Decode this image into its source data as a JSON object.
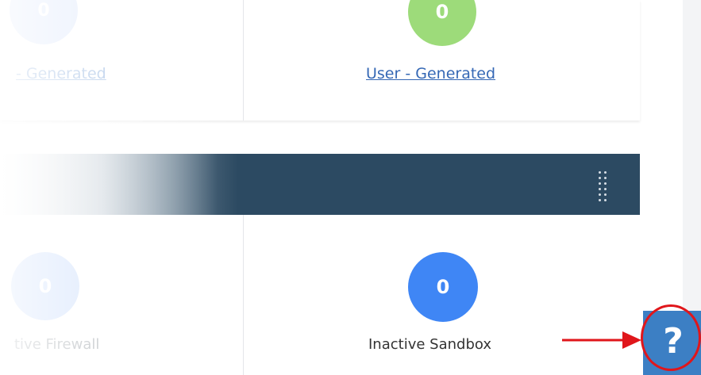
{
  "widgets": {
    "top": {
      "left": {
        "count": "0",
        "label": "- Generated",
        "color": "#dbe6fb"
      },
      "right": {
        "count": "0",
        "label": "User - Generated",
        "color": "#9ddb7a"
      }
    },
    "bottom": {
      "left": {
        "count": "0",
        "label": "tive Firewall",
        "color": "#c5d9fb"
      },
      "right": {
        "count": "0",
        "label": "Inactive Sandbox",
        "color": "#3f86f5"
      }
    }
  },
  "header": {
    "color": "#2c4a62",
    "menu_icon": "vertical-dots-grip-icon"
  },
  "help_button": {
    "label": "?",
    "color": "#3c7fc4",
    "highlight_color": "#e0161b"
  },
  "link_color": "#3568b5"
}
